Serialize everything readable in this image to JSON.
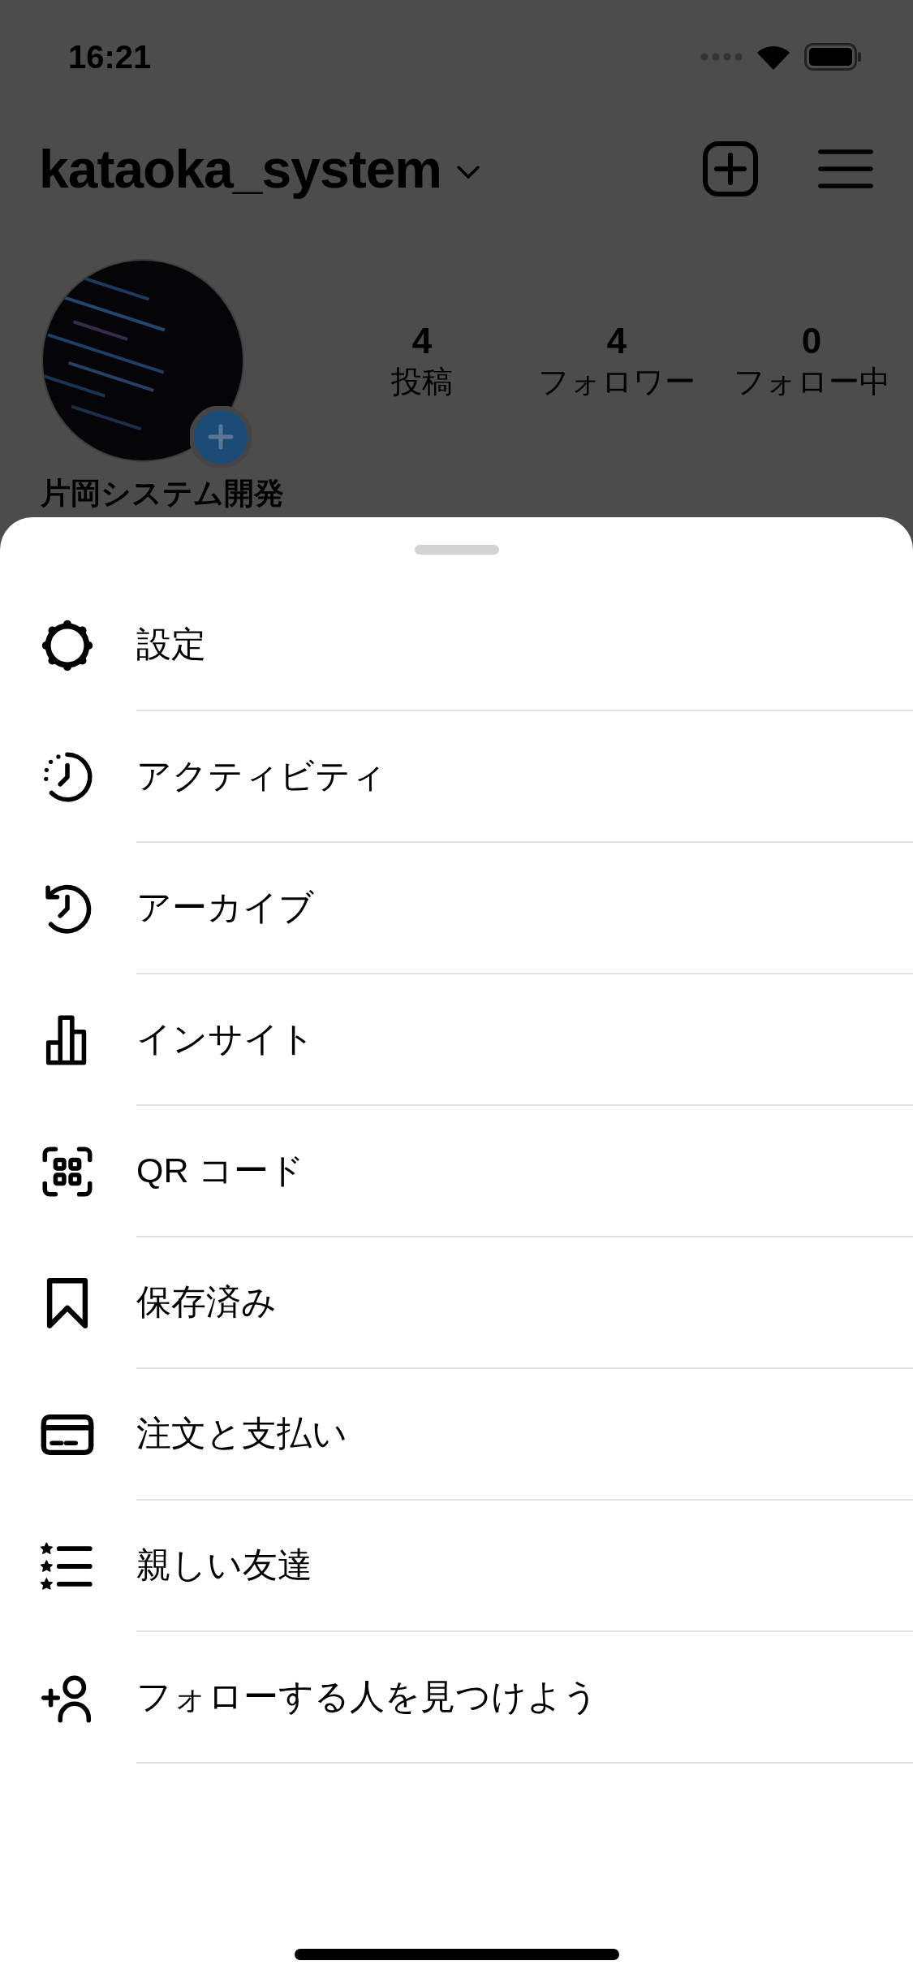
{
  "status_bar": {
    "time": "16:21"
  },
  "header": {
    "username": "kataoka_system"
  },
  "profile": {
    "stats": [
      {
        "value": "4",
        "label": "投稿"
      },
      {
        "value": "4",
        "label": "フォロワー"
      },
      {
        "value": "0",
        "label": "フォロー中"
      }
    ],
    "name": "片岡システム開発"
  },
  "menu": {
    "items": [
      {
        "kind": "settings",
        "label": "設定"
      },
      {
        "kind": "activity",
        "label": "アクティビティ"
      },
      {
        "kind": "archive",
        "label": "アーカイブ"
      },
      {
        "kind": "insights",
        "label": "インサイト"
      },
      {
        "kind": "qr",
        "label": "QR コード"
      },
      {
        "kind": "saved",
        "label": "保存済み"
      },
      {
        "kind": "payments",
        "label": "注文と支払い"
      },
      {
        "kind": "close_friends",
        "label": "親しい友達"
      },
      {
        "kind": "discover",
        "label": "フォローする人を見つけよう"
      }
    ]
  }
}
